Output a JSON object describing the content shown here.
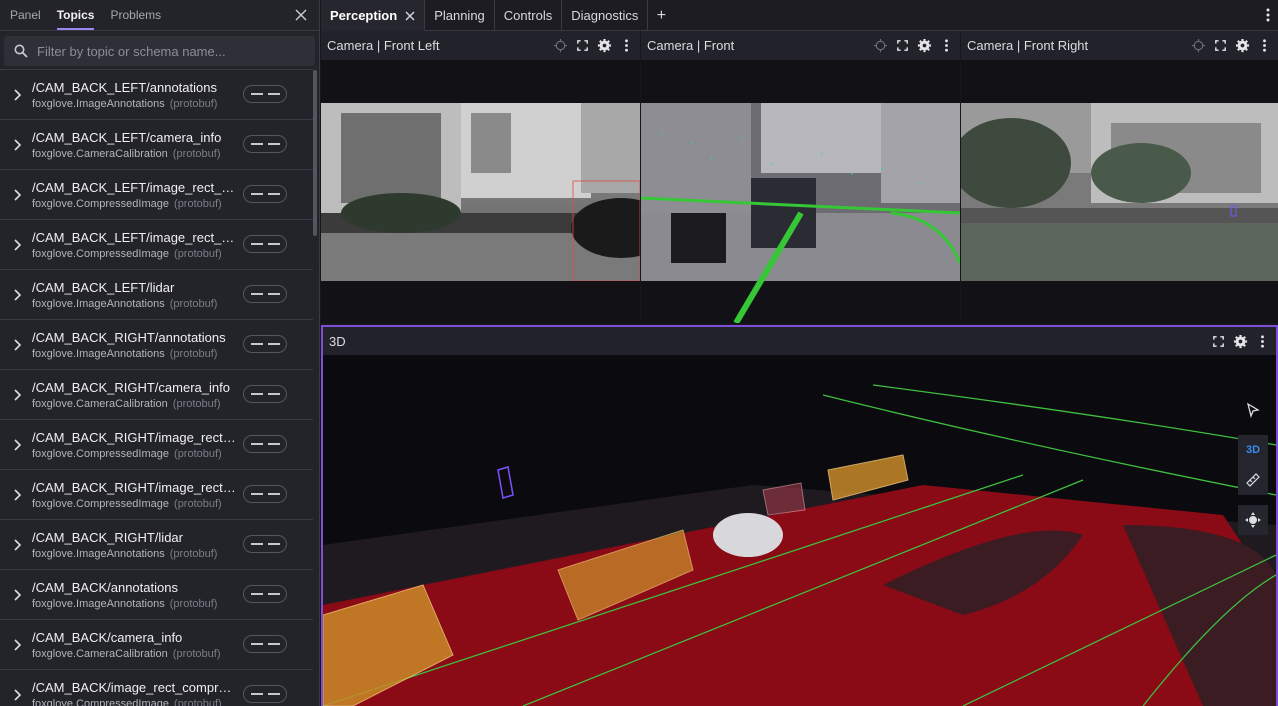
{
  "sidebar": {
    "tabs": [
      {
        "label": "Panel"
      },
      {
        "label": "Topics"
      },
      {
        "label": "Problems"
      }
    ],
    "filter_placeholder": "Filter by topic or schema name...",
    "topics": [
      {
        "name": "/CAM_BACK_LEFT/annotations",
        "schema": "foxglove.ImageAnnotations",
        "encoding": "(protobuf)"
      },
      {
        "name": "/CAM_BACK_LEFT/camera_info",
        "schema": "foxglove.CameraCalibration",
        "encoding": "(protobuf)"
      },
      {
        "name": "/CAM_BACK_LEFT/image_rect_co...",
        "schema": "foxglove.CompressedImage",
        "encoding": "(protobuf)"
      },
      {
        "name": "/CAM_BACK_LEFT/image_rect_co...",
        "schema": "foxglove.CompressedImage",
        "encoding": "(protobuf)"
      },
      {
        "name": "/CAM_BACK_LEFT/lidar",
        "schema": "foxglove.ImageAnnotations",
        "encoding": "(protobuf)"
      },
      {
        "name": "/CAM_BACK_RIGHT/annotations",
        "schema": "foxglove.ImageAnnotations",
        "encoding": "(protobuf)"
      },
      {
        "name": "/CAM_BACK_RIGHT/camera_info",
        "schema": "foxglove.CameraCalibration",
        "encoding": "(protobuf)"
      },
      {
        "name": "/CAM_BACK_RIGHT/image_rect_co...",
        "schema": "foxglove.CompressedImage",
        "encoding": "(protobuf)"
      },
      {
        "name": "/CAM_BACK_RIGHT/image_rect_co...",
        "schema": "foxglove.CompressedImage",
        "encoding": "(protobuf)"
      },
      {
        "name": "/CAM_BACK_RIGHT/lidar",
        "schema": "foxglove.ImageAnnotations",
        "encoding": "(protobuf)"
      },
      {
        "name": "/CAM_BACK/annotations",
        "schema": "foxglove.ImageAnnotations",
        "encoding": "(protobuf)"
      },
      {
        "name": "/CAM_BACK/camera_info",
        "schema": "foxglove.CameraCalibration",
        "encoding": "(protobuf)"
      },
      {
        "name": "/CAM_BACK/image_rect_compres...",
        "schema": "foxglove.CompressedImage",
        "encoding": "(protobuf)"
      }
    ]
  },
  "layout_tabs": [
    {
      "label": "Perception"
    },
    {
      "label": "Planning"
    },
    {
      "label": "Controls"
    },
    {
      "label": "Diagnostics"
    }
  ],
  "panels": {
    "cam_front_left": {
      "title": "Camera | Front Left"
    },
    "cam_front": {
      "title": "Camera | Front"
    },
    "cam_front_right": {
      "title": "Camera | Front Right"
    },
    "three_d": {
      "title": "3D"
    }
  },
  "viewport_toolbar": {
    "mode_label": "3D"
  },
  "colors": {
    "accent": "#9b86f4",
    "panel_focus_border": "#7e4fd9",
    "drivable_area": "#8a0a15",
    "lane_lines": "#3fbf3f",
    "bounding_box": "#e8a640"
  }
}
